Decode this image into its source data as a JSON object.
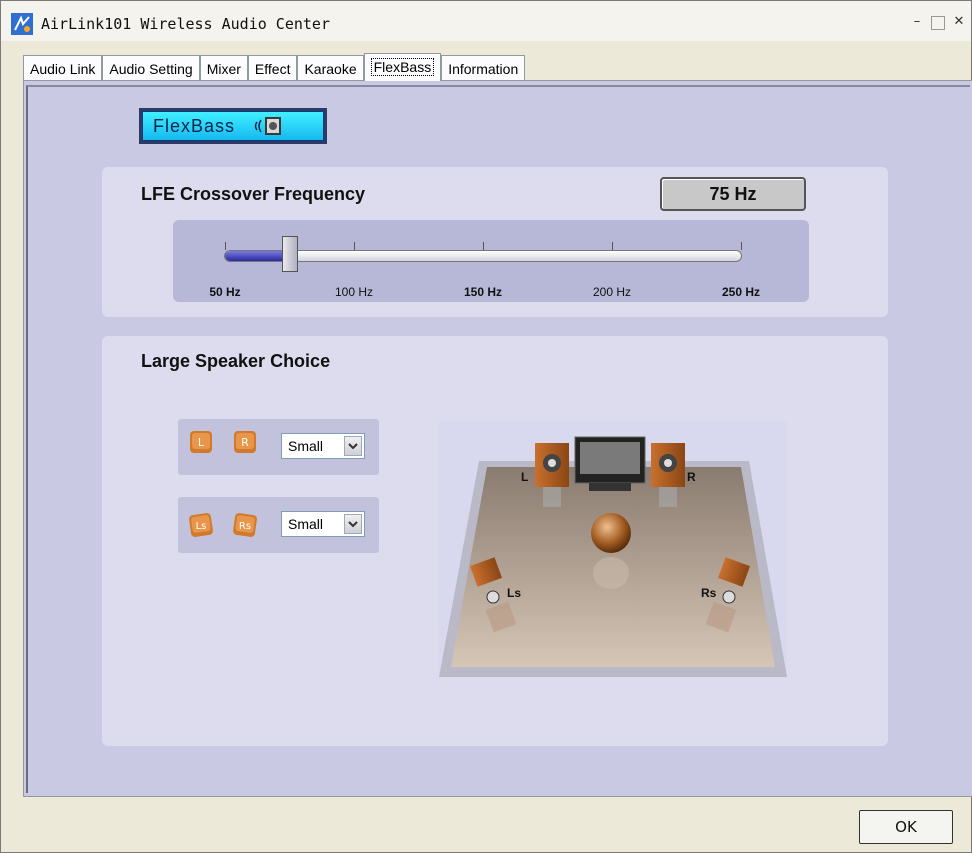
{
  "window": {
    "title": "AirLink101 Wireless Audio Center"
  },
  "tabs": [
    {
      "label": "Audio Link"
    },
    {
      "label": "Audio Setting"
    },
    {
      "label": "Mixer"
    },
    {
      "label": "Effect"
    },
    {
      "label": "Karaoke"
    },
    {
      "label": "FlexBass",
      "active": true
    },
    {
      "label": "Information"
    }
  ],
  "flexbass": {
    "button_label": "FlexBass"
  },
  "lfe": {
    "title": "LFE Crossover Frequency",
    "value_display": "75 Hz",
    "value": 75,
    "min": 50,
    "max": 250,
    "ticks": [
      {
        "label": "50 Hz",
        "bold": true
      },
      {
        "label": "100 Hz",
        "bold": false
      },
      {
        "label": "150 Hz",
        "bold": true
      },
      {
        "label": "200 Hz",
        "bold": false
      },
      {
        "label": "250 Hz",
        "bold": true
      }
    ]
  },
  "speaker": {
    "title": "Large Speaker Choice",
    "front": {
      "left_icon": "L",
      "right_icon": "R",
      "value": "Small"
    },
    "surround": {
      "left_icon": "Ls",
      "right_icon": "Rs",
      "value": "Small"
    },
    "room_labels": {
      "l": "L",
      "r": "R",
      "ls": "Ls",
      "rs": "Rs"
    }
  },
  "footer": {
    "ok_label": "OK"
  },
  "colors": {
    "panel": "#c9c9e4",
    "section": "#dcdcee",
    "accent": "#17b8f0",
    "fill": "#2a2aa0"
  }
}
